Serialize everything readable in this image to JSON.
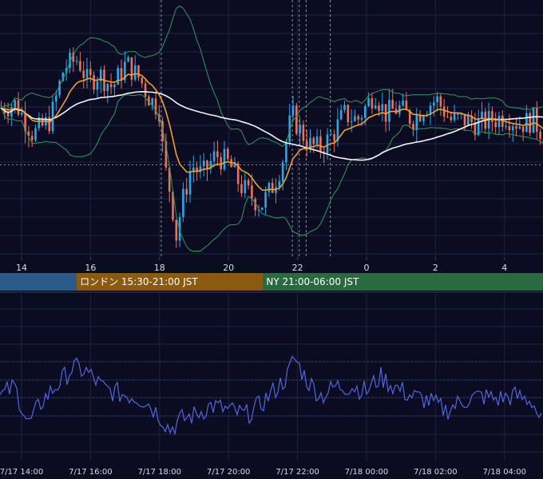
{
  "colors": {
    "background": "#0b0c22",
    "grid": "#1f2340",
    "candle_up": "#2aa8e8",
    "candle_down": "#e8735a",
    "ema_short": "#f0a030",
    "ema_long": "#f4f4f4",
    "bollinger": "#2f9a5a",
    "oscillator": "#5565e0",
    "session_tokyo": "#2a5a8a",
    "session_london": "#8a5a10",
    "session_ny": "#2a6a40"
  },
  "sessions": [
    {
      "id": "tokyo",
      "label": ""
    },
    {
      "id": "london",
      "label": "ロンドン 15:30-21:00 JST"
    },
    {
      "id": "ny",
      "label": "NY 21:00-06:00 JST"
    }
  ],
  "chart_data": {
    "type": "line",
    "upper_x_ticks": [
      "14",
      "16",
      "18",
      "20",
      "22",
      "0",
      "2",
      "4"
    ],
    "lower_x_ticks": [
      "7/17 14:00",
      "7/17 16:00",
      "7/17 18:00",
      "7/17 20:00",
      "7/17 22:00",
      "7/18 00:00",
      "7/18 02:00",
      "7/18 04:00"
    ],
    "x_start_hour": 13.4,
    "x_end_hour": 29.3,
    "dashed_event_hours": [
      18.05,
      21.85,
      22.05,
      22.25,
      22.95
    ],
    "price_reference": 0.3,
    "price_anchors": [
      [
        13.4,
        0.58
      ],
      [
        13.8,
        0.6
      ],
      [
        14.3,
        0.45
      ],
      [
        14.8,
        0.52
      ],
      [
        15.2,
        0.78
      ],
      [
        15.6,
        0.82
      ],
      [
        15.9,
        0.7
      ],
      [
        16.2,
        0.75
      ],
      [
        16.6,
        0.68
      ],
      [
        17.0,
        0.8
      ],
      [
        17.4,
        0.72
      ],
      [
        17.7,
        0.62
      ],
      [
        17.95,
        0.58
      ],
      [
        18.1,
        0.3
      ],
      [
        18.3,
        0.15
      ],
      [
        18.45,
        -0.05
      ],
      [
        18.6,
        0.1
      ],
      [
        18.9,
        0.3
      ],
      [
        19.2,
        0.25
      ],
      [
        19.6,
        0.35
      ],
      [
        20.0,
        0.3
      ],
      [
        20.3,
        0.2
      ],
      [
        20.6,
        0.15
      ],
      [
        20.9,
        0.1
      ],
      [
        21.2,
        0.18
      ],
      [
        21.5,
        0.3
      ],
      [
        21.8,
        0.55
      ],
      [
        22.0,
        0.48
      ],
      [
        22.3,
        0.4
      ],
      [
        22.6,
        0.38
      ],
      [
        23.0,
        0.45
      ],
      [
        23.3,
        0.55
      ],
      [
        23.7,
        0.52
      ],
      [
        24.0,
        0.6
      ],
      [
        24.2,
        0.66
      ],
      [
        24.5,
        0.55
      ],
      [
        24.9,
        0.58
      ],
      [
        25.3,
        0.52
      ],
      [
        25.6,
        0.58
      ],
      [
        26.0,
        0.62
      ],
      [
        26.4,
        0.52
      ],
      [
        26.8,
        0.52
      ],
      [
        27.2,
        0.5
      ],
      [
        27.6,
        0.52
      ],
      [
        28.0,
        0.54
      ],
      [
        28.4,
        0.5
      ],
      [
        28.8,
        0.52
      ],
      [
        29.1,
        0.45
      ],
      [
        29.3,
        0.44
      ]
    ],
    "oscillator_anchors": [
      [
        13.4,
        0.45
      ],
      [
        13.8,
        0.55
      ],
      [
        14.2,
        0.15
      ],
      [
        14.6,
        0.4
      ],
      [
        15.0,
        0.55
      ],
      [
        15.5,
        0.75
      ],
      [
        15.9,
        0.7
      ],
      [
        16.4,
        0.52
      ],
      [
        16.8,
        0.48
      ],
      [
        17.2,
        0.45
      ],
      [
        17.6,
        0.4
      ],
      [
        18.0,
        0.25
      ],
      [
        18.3,
        0.1
      ],
      [
        18.6,
        0.2
      ],
      [
        19.0,
        0.25
      ],
      [
        19.5,
        0.35
      ],
      [
        20.0,
        0.3
      ],
      [
        20.5,
        0.25
      ],
      [
        20.9,
        0.35
      ],
      [
        21.3,
        0.5
      ],
      [
        21.7,
        0.65
      ],
      [
        21.9,
        0.85
      ],
      [
        22.3,
        0.6
      ],
      [
        22.7,
        0.45
      ],
      [
        23.1,
        0.55
      ],
      [
        23.6,
        0.55
      ],
      [
        24.0,
        0.5
      ],
      [
        24.4,
        0.65
      ],
      [
        24.8,
        0.55
      ],
      [
        25.3,
        0.45
      ],
      [
        25.8,
        0.4
      ],
      [
        26.3,
        0.3
      ],
      [
        26.8,
        0.4
      ],
      [
        27.3,
        0.45
      ],
      [
        27.8,
        0.42
      ],
      [
        28.3,
        0.45
      ],
      [
        28.8,
        0.4
      ],
      [
        29.1,
        0.15
      ],
      [
        29.3,
        0.25
      ]
    ]
  }
}
